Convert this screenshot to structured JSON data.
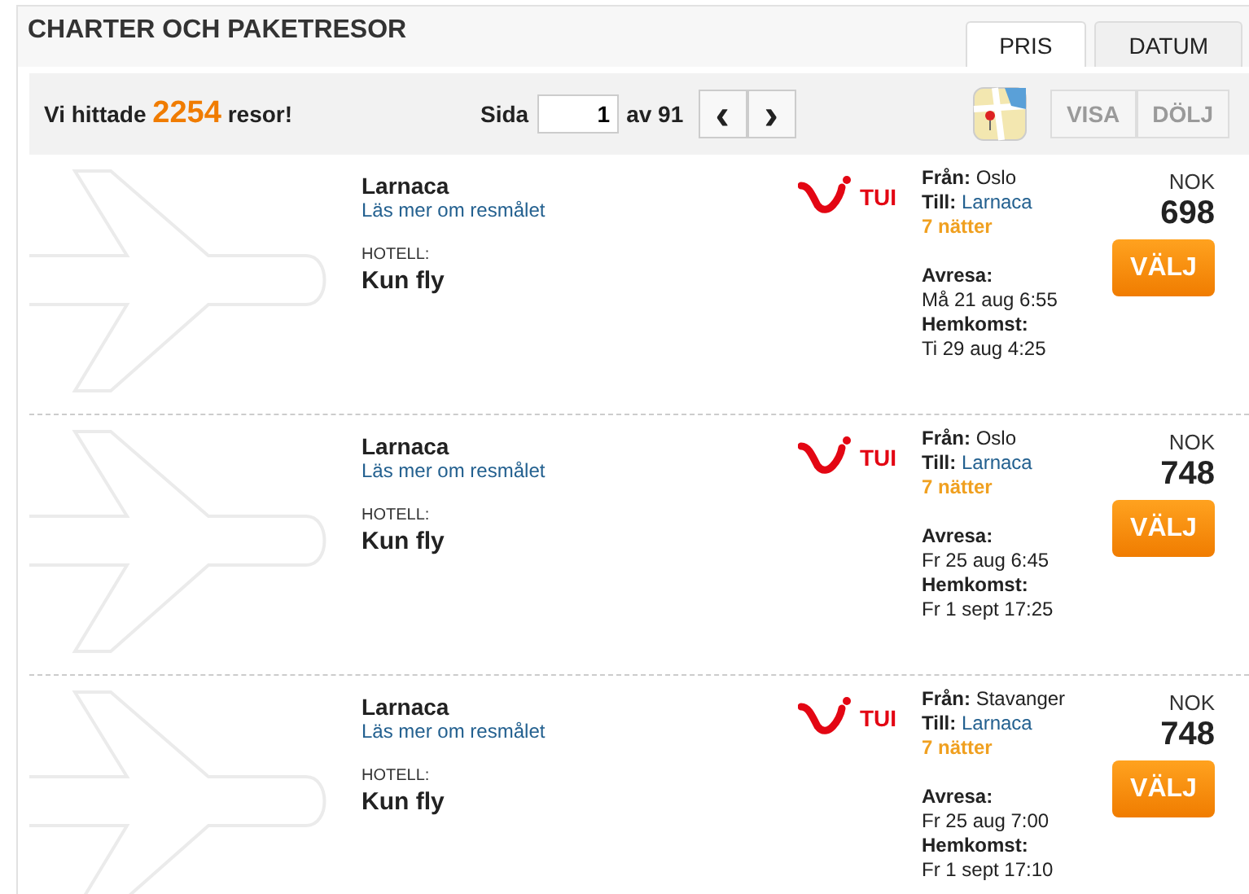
{
  "header": {
    "title": "CHARTER OCH PAKETRESOR"
  },
  "tabs": [
    {
      "label": "PRIS",
      "selected": true
    },
    {
      "label": "DATUM",
      "selected": false
    }
  ],
  "toolbar": {
    "found_prefix": "Vi hittade",
    "count": "2254",
    "found_suffix": "resor!",
    "page_label": "Sida",
    "page_value": "1",
    "page_of": "av 91",
    "prev": "‹",
    "next": "›",
    "map_buttons": [
      {
        "label": "VISA",
        "disabled": true
      },
      {
        "label": "DÖLJ",
        "disabled": true
      }
    ]
  },
  "trips": [
    {
      "destination": "Larnaca",
      "link": "Läs mer om resmålet",
      "hotel_label": "HOTELL:",
      "hotel": "Kun fly",
      "operator": "TUI",
      "from_label": "Från:",
      "from": "Oslo",
      "to_label": "Till:",
      "to": "Larnaca",
      "nights": "7 nätter",
      "depart_label": "Avresa:",
      "depart": "Må 21 aug 6:55",
      "return_label": "Hemkomst:",
      "return": "Ti 29 aug 4:25",
      "currency": "NOK",
      "price": "698",
      "button": "VÄLJ"
    },
    {
      "destination": "Larnaca",
      "link": "Läs mer om resmålet",
      "hotel_label": "HOTELL:",
      "hotel": "Kun fly",
      "operator": "TUI",
      "from_label": "Från:",
      "from": "Oslo",
      "to_label": "Till:",
      "to": "Larnaca",
      "nights": "7 nätter",
      "depart_label": "Avresa:",
      "depart": "Fr 25 aug 6:45",
      "return_label": "Hemkomst:",
      "return": "Fr 1 sept 17:25",
      "currency": "NOK",
      "price": "748",
      "button": "VÄLJ"
    },
    {
      "destination": "Larnaca",
      "link": "Läs mer om resmålet",
      "hotel_label": "HOTELL:",
      "hotel": "Kun fly",
      "operator": "TUI",
      "from_label": "Från:",
      "from": "Stavanger",
      "to_label": "Till:",
      "to": "Larnaca",
      "nights": "7 nätter",
      "depart_label": "Avresa:",
      "depart": "Fr 25 aug 7:00",
      "return_label": "Hemkomst:",
      "return": "Fr 1 sept 17:10",
      "currency": "NOK",
      "price": "748",
      "button": "VÄLJ"
    }
  ]
}
